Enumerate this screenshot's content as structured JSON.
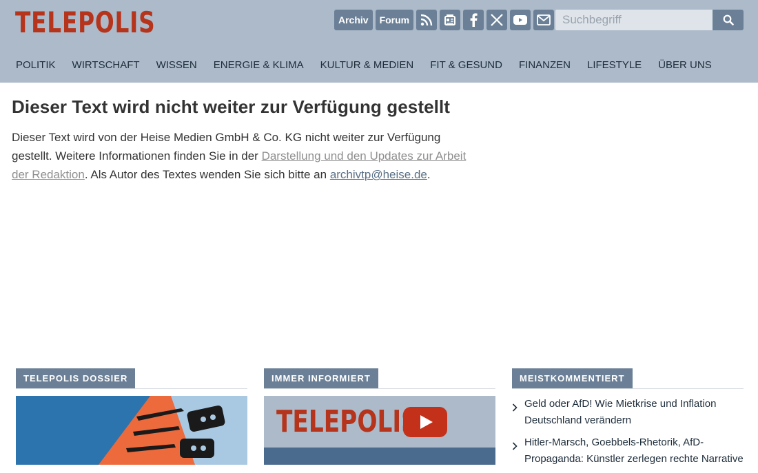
{
  "header": {
    "logo": "TELEPOLIS",
    "top_buttons": {
      "archiv": "Archiv",
      "forum": "Forum"
    },
    "icons": [
      "rss-icon",
      "newspaper-icon",
      "facebook-icon",
      "x-icon",
      "youtube-icon",
      "mail-icon"
    ],
    "search": {
      "placeholder": "Suchbegriff"
    }
  },
  "nav": [
    "POLITIK",
    "WIRTSCHAFT",
    "WISSEN",
    "ENERGIE & KLIMA",
    "KULTUR & MEDIEN",
    "FIT & GESUND",
    "FINANZEN",
    "LIFESTYLE",
    "ÜBER UNS"
  ],
  "article": {
    "title": "Dieser Text wird nicht weiter zur Verfügung gestellt",
    "p1": "Dieser Text wird von der Heise Medien GmbH & Co. KG nicht weiter zur Verfügung gestellt. Weitere Informationen finden Sie in der ",
    "link1": "Darstellung und den Updates zur Arbeit der Redaktion",
    "p2": ". Als Autor des Textes wenden Sie sich bitte an ",
    "link2": "archivtp@heise.de",
    "p3": "."
  },
  "sections": {
    "dossier": {
      "label": "TELEPOLIS DOSSIER"
    },
    "informiert": {
      "label": "IMMER INFORMIERT",
      "banner_text": "TELEPOLIS"
    },
    "meist": {
      "label": "MEISTKOMMENTIERT",
      "items": [
        "Geld oder AfD! Wie Mietkrise und Inflation Deutschland verändern",
        "Hitler-Marsch, Goebbels-Rhetorik, AfD-Propaganda: Künstler zerlegen rechte Narrative"
      ]
    }
  },
  "colors": {
    "header_bg": "#acbac9",
    "logo": "#b5341b",
    "button": "#6b8097",
    "youtube_red": "#c4311a"
  }
}
